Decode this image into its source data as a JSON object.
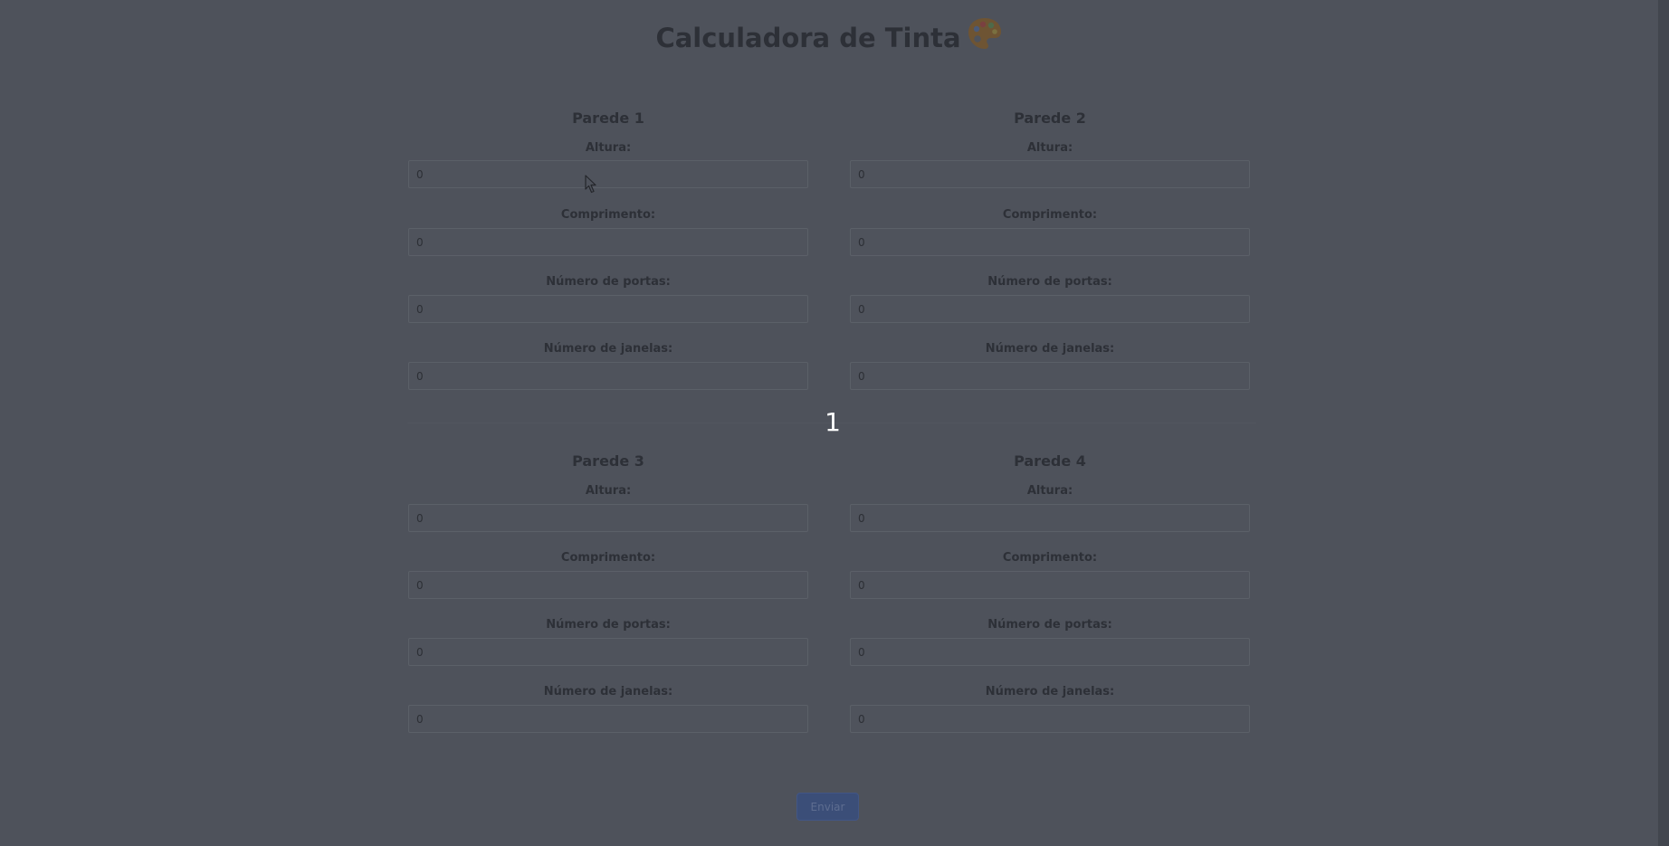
{
  "app": {
    "title": "Calculadora de Tinta",
    "title_icon": "palette-icon"
  },
  "labels": {
    "height": "Altura:",
    "length": "Comprimento:",
    "doors": "Número de portas:",
    "windows": "Número de janelas:"
  },
  "walls": [
    {
      "title": "Parede 1",
      "height": "0",
      "length": "0",
      "doors": "0",
      "windows": "0"
    },
    {
      "title": "Parede 2",
      "height": "0",
      "length": "0",
      "doors": "0",
      "windows": "0"
    },
    {
      "title": "Parede 3",
      "height": "0",
      "length": "0",
      "doors": "0",
      "windows": "0"
    },
    {
      "title": "Parede 4",
      "height": "0",
      "length": "0",
      "doors": "0",
      "windows": "0"
    }
  ],
  "overlay": {
    "number": "1"
  },
  "submit": {
    "label": "Enviar"
  },
  "colors": {
    "background": "#4e525b",
    "text": "#2d3037",
    "button": "#3b4e78",
    "overlay_number": "#ffffff"
  }
}
